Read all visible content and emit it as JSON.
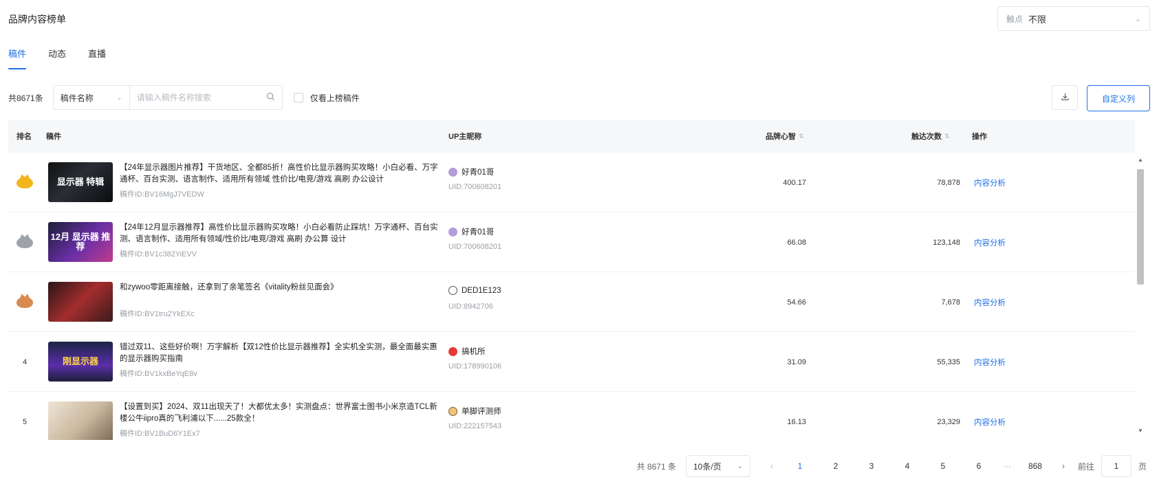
{
  "header": {
    "title": "品牌内容榜单",
    "touch_label": "触点",
    "touch_value": "不限"
  },
  "tabs": [
    {
      "label": "稿件",
      "active": true
    },
    {
      "label": "动态",
      "active": false
    },
    {
      "label": "直播",
      "active": false
    }
  ],
  "filters": {
    "total": "共8671条",
    "field": "稿件名称",
    "search_placeholder": "请输入稿件名称搜索",
    "checkbox_label": "仅看上榜稿件",
    "custom_columns": "自定义列"
  },
  "columns": {
    "rank": "排名",
    "work": "稿件",
    "up": "UP主昵称",
    "brand_heart": "品牌心智",
    "reach": "触达次数",
    "action": "操作"
  },
  "rows": [
    {
      "rank": "1",
      "medal": "gold",
      "thumb_text": "显示器 特辑",
      "title": "【24年显示器图片推荐】干货地区、全都85折！高性价比显示器购买攻略！小白必看、万字通杯、百台实测、语言制作、适用所有领域 性价比/电竞/游戏 高刷 办公设计",
      "bvid": "稿件ID:BV16MgJ7VEDW",
      "up_name": "好青01哥",
      "uid": "UID:700608201",
      "brand_heart": "400.17",
      "reach": "78,878",
      "action": "内容分析"
    },
    {
      "rank": "2",
      "medal": "silver",
      "thumb_text": "12月 显示器 推荐",
      "title": "【24年12月显示器推荐】高性价比显示器购买攻略！小白必看防止踩坑！万字通杯、百台实测、语言制作、适用所有领域/性价比/电竞/游戏 高刷 办公算 设计",
      "bvid": "稿件ID:BV1c382YiEVV",
      "up_name": "好青01哥",
      "uid": "UID:700608201",
      "brand_heart": "66.08",
      "reach": "123,148",
      "action": "内容分析"
    },
    {
      "rank": "3",
      "medal": "bronze",
      "thumb_text": "",
      "title": "和zywoo零距离接触，还拿到了亲笔签名《vitality粉丝见面会》",
      "bvid": "稿件ID:BV1tru2YkEXc",
      "up_name": "DED1E123",
      "uid": "UID:8942706",
      "brand_heart": "54.66",
      "reach": "7,678",
      "action": "内容分析"
    },
    {
      "rank": "4",
      "medal": "",
      "thumb_text": "刚显示器",
      "title": "错过双11、这些好价啊！万字解析【双12性价比显示器推荐】全实机全实测，最全面最实惠的显示器购买指南",
      "bvid": "稿件ID:BV1kxBeYqE8v",
      "up_name": "搞机所",
      "uid": "UID:178990106",
      "brand_heart": "31.09",
      "reach": "55,335",
      "action": "内容分析"
    },
    {
      "rank": "5",
      "medal": "",
      "thumb_text": "",
      "title": "【设置到买】2024、双11出现天了！大都优太多！实测盘点：世界富士图书小米京造TCL新楼公牛iipro真的飞利浦以下......25款全！",
      "bvid": "稿件ID:BV1BuD6Y1Ex7",
      "up_name": "单脚评测师",
      "uid": "UID:222157543",
      "brand_heart": "16.13",
      "reach": "23,329",
      "action": "内容分析"
    }
  ],
  "pagination": {
    "total": "共 8671 条",
    "page_size": "10条/页",
    "pages": [
      "1",
      "2",
      "3",
      "4",
      "5",
      "6"
    ],
    "ellipsis": "···",
    "last": "868",
    "goto": "前往",
    "goto_value": "1",
    "page_suffix": "页"
  },
  "colors": {
    "accent": "#1f6fe5",
    "gold": "#f2b51a",
    "silver": "#9ea3aa",
    "bronze": "#d98a4f"
  }
}
